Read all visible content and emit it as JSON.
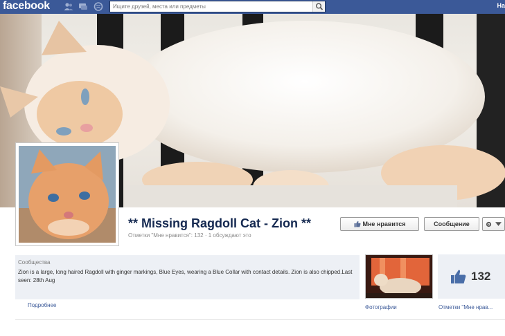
{
  "topbar": {
    "logo": "facebook",
    "search_placeholder": "Ищите друзей, места или предметы",
    "right_text": "На"
  },
  "page": {
    "name": "** Missing Ragdoll Cat - Zion **",
    "subline": "Отметки \"Мне нравится\": 132 · 1 обсуждают это",
    "like_button": "Мне нравится",
    "message_button": "Сообщение"
  },
  "about": {
    "label": "Сообщества",
    "text": "Zion is a large, long haired Ragdoll with ginger markings, Blue Eyes, wearing a Blue Collar with contact details. Zion is also chipped.Last seen: 28th Aug",
    "more": "Подробнее"
  },
  "apps": {
    "photos_label": "Фотографии",
    "likes_count": "132",
    "likes_label": "Отметки \"Мне нрав..."
  },
  "colors": {
    "brand": "#3b5998",
    "name": "#142850"
  }
}
